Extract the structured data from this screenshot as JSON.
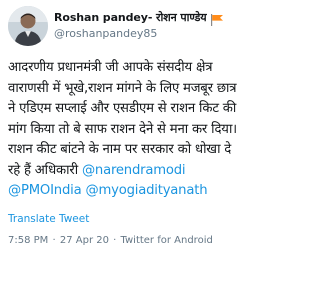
{
  "user": {
    "display_name": "Roshan pandey- रोशन पाण्डेय",
    "handle": "@roshanpandey85",
    "flag_icon": "saffron-flag-icon"
  },
  "tweet": {
    "text": "आदरणीय प्रधानमंत्री जी आपके संसदीय क्षेत्र वाराणसी में भूखे,राशन मांगने के लिए मजबूर छात्र ने एडिएम सप्लाई और एसडीएम से राशन किट की मांग किया तो बे साफ राशन देने से मना कर दिया।राशन कीट बांटने के नाम पर सरकार को धोखा दे रहे हैं अधिकारी ",
    "mentions": [
      "@narendramodi",
      "@PMOIndia",
      "@myogiadityanath"
    ]
  },
  "translate_label": "Translate Tweet",
  "meta": {
    "time": "7:58 PM",
    "date": "27 Apr 20",
    "separator": "·",
    "source": "Twitter for Android"
  },
  "colors": {
    "link": "#1b95e0",
    "secondary": "#657786",
    "flag": "#ff8c1a"
  }
}
